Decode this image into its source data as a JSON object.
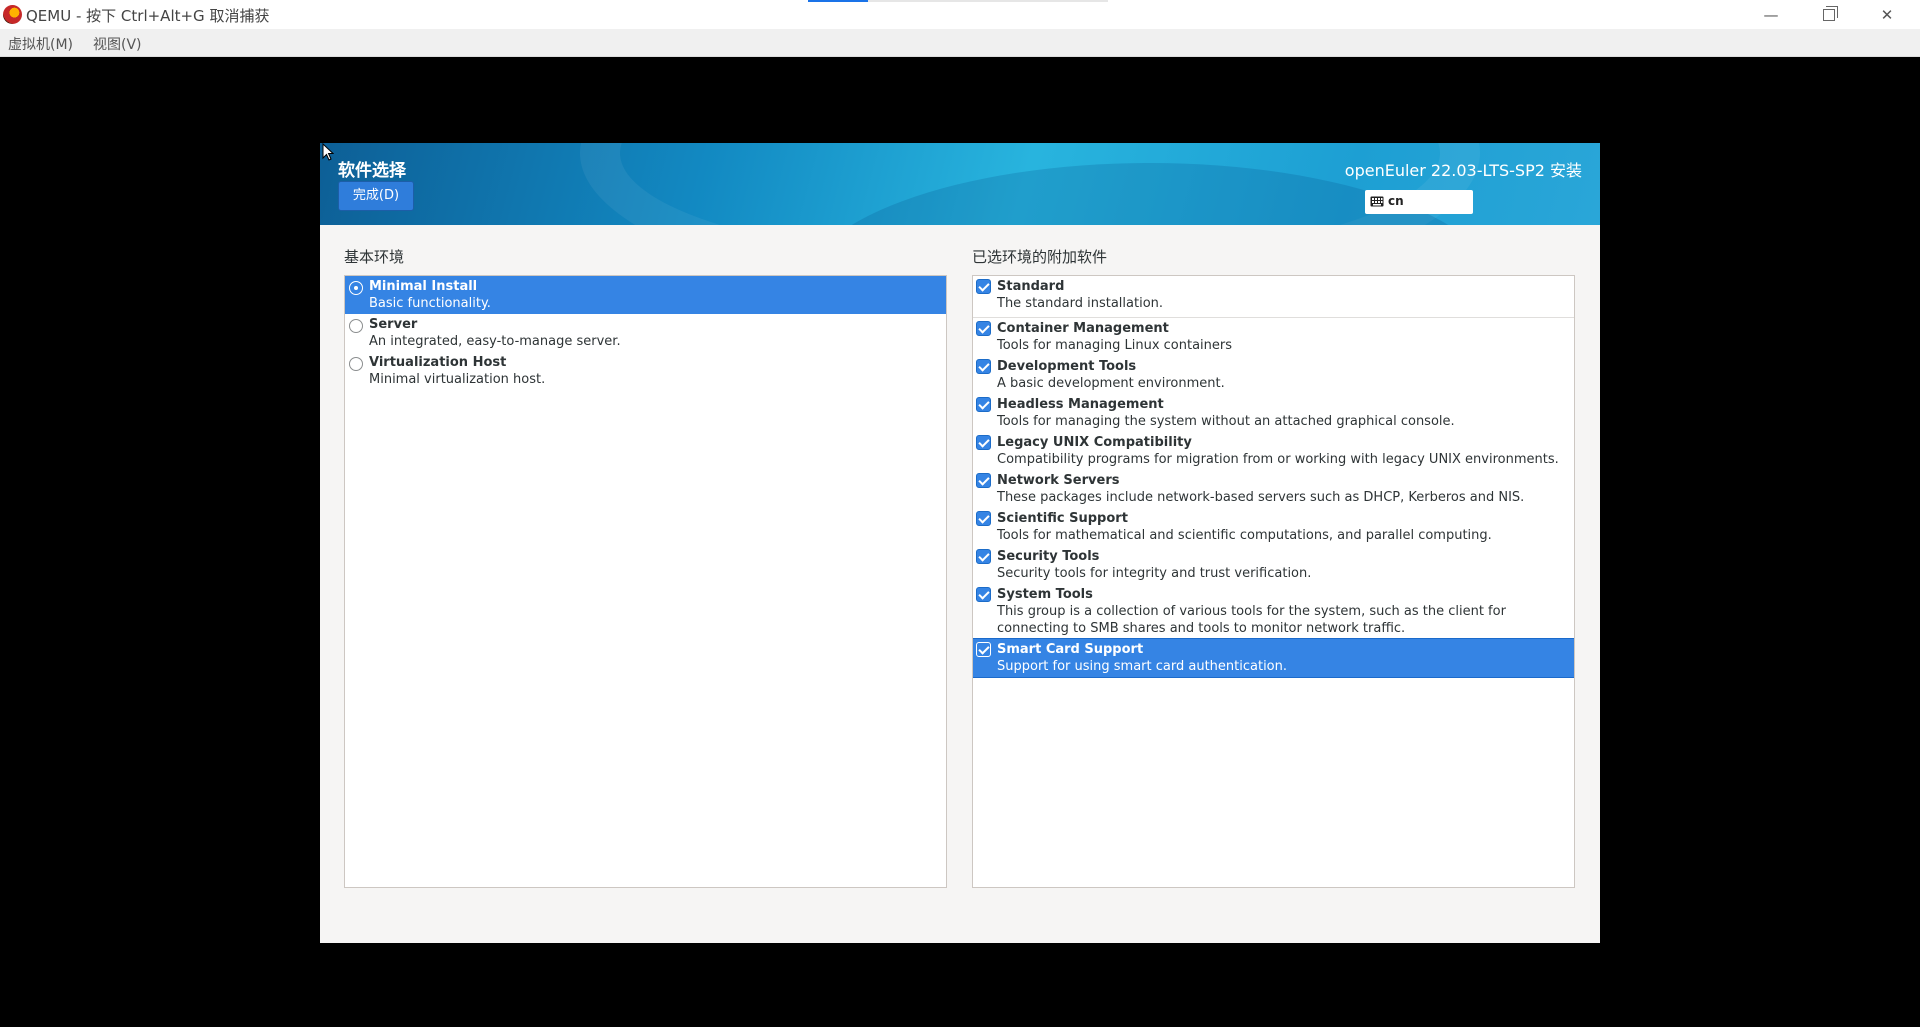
{
  "window": {
    "title": "QEMU - 按下 Ctrl+Alt+G 取消捕获",
    "minimize_glyph": "—",
    "close_glyph": "✕"
  },
  "menubar": {
    "items": [
      "虚拟机(M)",
      "视图(V)"
    ]
  },
  "installer": {
    "page_title": "软件选择",
    "done_button": "完成(D)",
    "product_title": "openEuler 22.03-LTS-SP2 安装",
    "keyboard_layout": "cn",
    "left_section_label": "基本环境",
    "right_section_label": "已选环境的附加软件",
    "environments": [
      {
        "title": "Minimal Install",
        "desc": "Basic functionality.",
        "selected": true
      },
      {
        "title": "Server",
        "desc": "An integrated, easy-to-manage server.",
        "selected": false
      },
      {
        "title": "Virtualization Host",
        "desc": "Minimal virtualization host.",
        "selected": false
      }
    ],
    "addons": [
      {
        "title": "Standard",
        "desc": "The standard installation.",
        "checked": true
      },
      {
        "title": "Container Management",
        "desc": "Tools for managing Linux containers",
        "checked": true
      },
      {
        "title": "Development Tools",
        "desc": "A basic development environment.",
        "checked": true
      },
      {
        "title": "Headless Management",
        "desc": "Tools for managing the system without an attached graphical console.",
        "checked": true
      },
      {
        "title": "Legacy UNIX Compatibility",
        "desc": "Compatibility programs for migration from or working with legacy UNIX environments.",
        "checked": true
      },
      {
        "title": "Network Servers",
        "desc": "These packages include network-based servers such as DHCP, Kerberos and NIS.",
        "checked": true
      },
      {
        "title": "Scientific Support",
        "desc": "Tools for mathematical and scientific computations, and parallel computing.",
        "checked": true
      },
      {
        "title": "Security Tools",
        "desc": "Security tools for integrity and trust verification.",
        "checked": true
      },
      {
        "title": "System Tools",
        "desc": "This group is a collection of various tools for the system, such as the client for connecting to SMB shares and tools to monitor network traffic.",
        "checked": true
      },
      {
        "title": "Smart Card Support",
        "desc": "Support for using smart card authentication.",
        "checked": true,
        "selected": true
      }
    ]
  }
}
